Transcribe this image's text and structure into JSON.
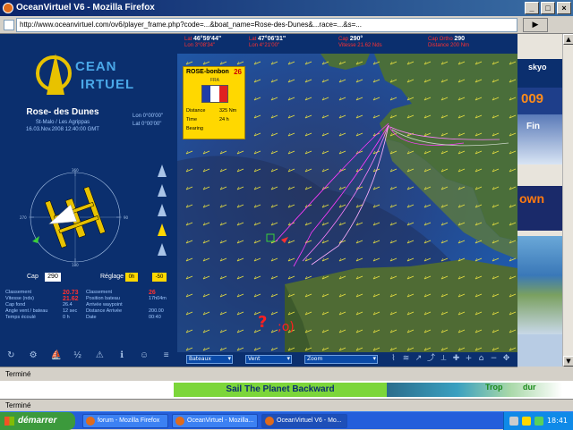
{
  "window": {
    "title": "OceanVirtuel V6 - Mozilla Firefox"
  },
  "address": {
    "url": "http://www.oceanvirtuel.com/ov6/player_frame.php?code=...&boat_name=Rose-des-Dunes&...race=...&s=..."
  },
  "logo": {
    "word1": "CEAN",
    "word2": "IRTUEL"
  },
  "boat": {
    "name": "Rose- des Dunes",
    "route": "St-Malo / Les Agrippas",
    "date": "16.03.Nov.2008 12:40:00 GMT",
    "lon": "Lon 0°00'00\"",
    "lat": "Lat 0°00'00\""
  },
  "controls": {
    "cap_label": "Cap",
    "cap_value": "290",
    "reglage_label": "Réglage",
    "reglage_value": "0h",
    "reglage_value2": "-50"
  },
  "stats": [
    {
      "l1": "Classement",
      "v1": "20.73",
      "l2": "Classement",
      "v2": "26"
    },
    {
      "l1": "Vitesse (nds)",
      "v1": "21.62",
      "l2": "Position bateau",
      "v2": "17h04m"
    },
    {
      "l1": "Cap fond",
      "v1": "26.4",
      "l2": "Arrivée waypoint",
      "v2": ""
    },
    {
      "l1": "Angle vent / bateau",
      "v1": "12 sec",
      "l2": "Distance Arrivée",
      "v2": "200.00"
    },
    {
      "l1": "Temps écoulé",
      "v1": "0 h",
      "l2": "Date",
      "v2": "00:40"
    }
  ],
  "top_info": [
    {
      "a": "Lat",
      "b": "46°59'44\"",
      "c": "Lon 3°08'34\""
    },
    {
      "a": "Lat",
      "b": "47°06'31\"",
      "c": "Lon 4°21'00\""
    },
    {
      "a": "Cap",
      "b": "290°",
      "c": "Vitesse 21.62 Nds"
    },
    {
      "a": "Cap Ortho",
      "b": "290",
      "c": "Distance 200 Nm"
    }
  ],
  "popup": {
    "boat": "ROSE-bonbon",
    "rank": "26",
    "country": "FRA",
    "r1_label": "Distance",
    "r1_value": "325 Nm",
    "r2_label": "Time",
    "r2_value": "24 h",
    "r3_label": "Bearing",
    "r3_value": "",
    "flag_colors": [
      "#1f3ea8",
      "#ffffff",
      "#e02020"
    ]
  },
  "map_controls": {
    "select1": "Bateaux",
    "select2": "Vent",
    "select3": "Zoom"
  },
  "status": {
    "bar1": "Terminé",
    "bar2": "Terminé"
  },
  "banner": {
    "text": "Sail The Planet Backward",
    "right1": "Trop",
    "right2": "dur"
  },
  "right_ads": {
    "a1": "skyo",
    "a2": "009",
    "a3": "Fin",
    "a4": "own"
  },
  "taskbar": {
    "start": "démarrer",
    "tasks": [
      "forum - Mozilla Firefox",
      "OceanVirtuel - Mozilla...",
      "OceanVirtuel V6 - Mo..."
    ],
    "clock": "18:41"
  },
  "colors": {
    "panel": "#0b2f6e",
    "accent_yellow": "#ffd800",
    "accent_red": "#ff3030",
    "sea": "#1e5db0",
    "land": "#3d6b3a"
  }
}
